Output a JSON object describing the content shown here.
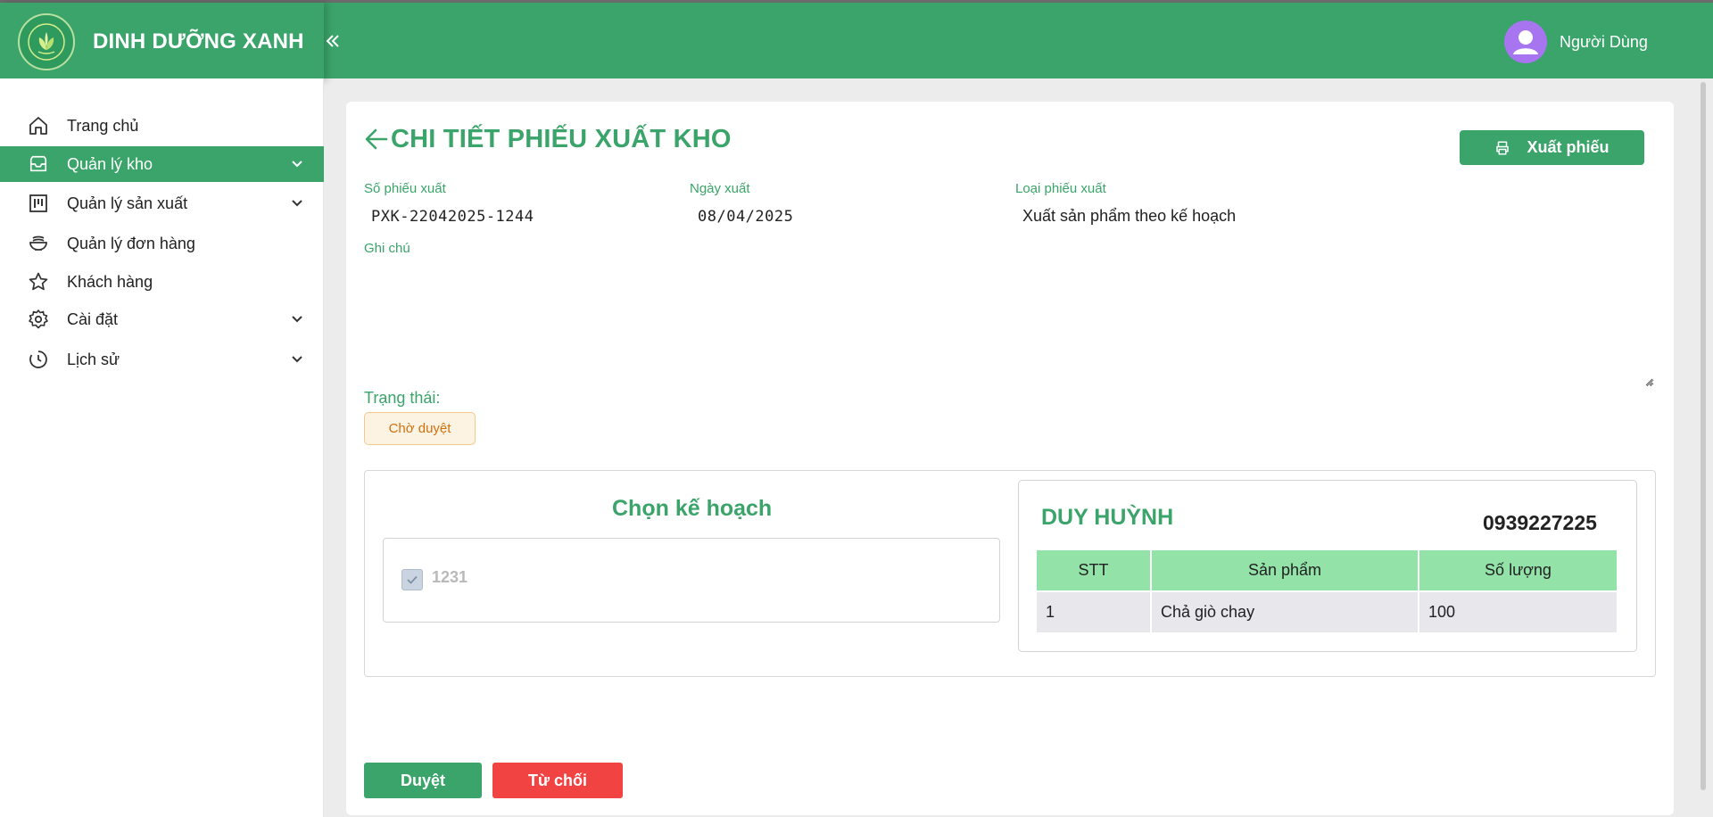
{
  "app": {
    "brand_name": "DINH DƯỠNG XANH",
    "logo_icon": "leaf-logo-icon",
    "collapse_icon": "double-chevron-left-icon",
    "user_name": "Người Dùng"
  },
  "colors": {
    "primary": "#3aa46a",
    "danger": "#f24343",
    "status_pending_bg": "#fdf3e2",
    "status_pending_text": "#d1700f",
    "table_header": "#93e2a8",
    "avatar": "#a675ef"
  },
  "sidebar": {
    "items": [
      {
        "label": "Trang chủ",
        "icon": "home-icon",
        "active": false,
        "has_submenu": false
      },
      {
        "label": "Quản lý kho",
        "icon": "inbox-icon",
        "active": true,
        "has_submenu": true
      },
      {
        "label": "Quản lý sản xuất",
        "icon": "kanban-icon",
        "active": false,
        "has_submenu": true
      },
      {
        "label": "Quản lý đơn hàng",
        "icon": "bowl-icon",
        "active": false,
        "has_submenu": false
      },
      {
        "label": "Khách hàng",
        "icon": "star-icon",
        "active": false,
        "has_submenu": false
      },
      {
        "label": "Cài đặt",
        "icon": "gear-icon",
        "active": false,
        "has_submenu": true
      },
      {
        "label": "Lịch sử",
        "icon": "history-icon",
        "active": false,
        "has_submenu": true
      }
    ]
  },
  "page": {
    "title": "CHI TIẾT PHIẾU XUẤT KHO",
    "export_button": "Xuất phiếu",
    "fields": {
      "receipt_no_label": "Số phiếu xuất",
      "receipt_no_value": "PXK-22042025-1244",
      "date_label": "Ngày xuất",
      "date_value": "08/04/2025",
      "type_label": "Loại phiếu xuất",
      "type_value": "Xuất sản phẩm theo kế hoạch",
      "note_label": "Ghi chú",
      "note_value": ""
    },
    "status": {
      "label": "Trạng thái:",
      "value": "Chờ duyệt"
    },
    "plan": {
      "title": "Chọn kế hoạch",
      "items": [
        {
          "code": "1231",
          "checked": true,
          "disabled": true
        }
      ]
    },
    "customer": {
      "name": "DUY HUỲNH",
      "phone": "0939227225",
      "table": {
        "headers": [
          "STT",
          "Sản phẩm",
          "Số lượng"
        ],
        "rows": [
          [
            "1",
            "Chả giò chay",
            "100"
          ]
        ]
      }
    },
    "actions": {
      "approve": "Duyệt",
      "reject": "Từ chối"
    }
  }
}
